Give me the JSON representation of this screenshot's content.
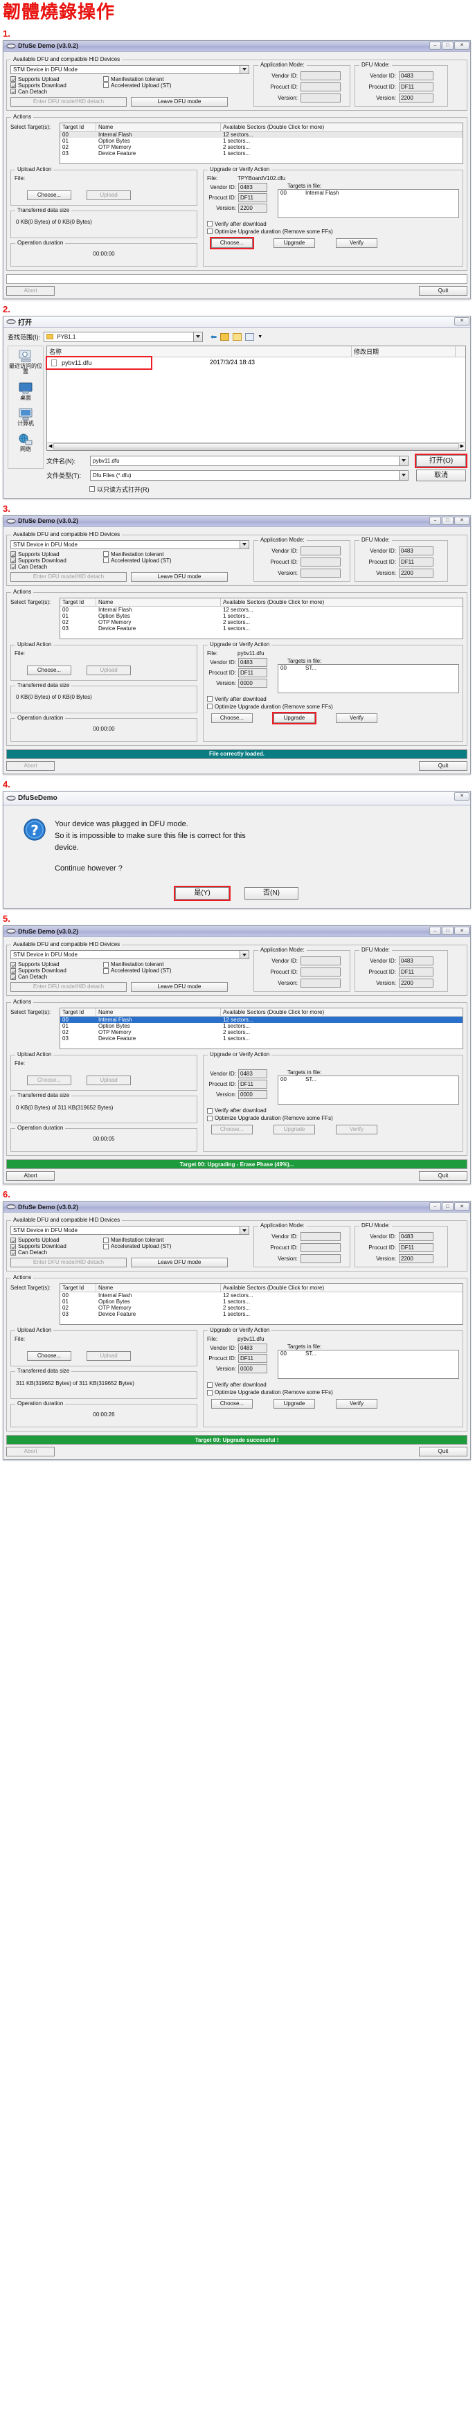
{
  "page_title": "韌體燒錄操作",
  "steps": {
    "s1": "1.",
    "s2": "2.",
    "s3": "3.",
    "s4": "4.",
    "s5": "5.",
    "s6": "6."
  },
  "app": {
    "title": "DfuSe Demo (v3.0.2)",
    "title_short": "DfuSeDemo",
    "group_devices": "Available DFU and compatible HID Devices",
    "device_selected": "STM Device in DFU Mode",
    "checks": {
      "supports_upload": "Supports Upload",
      "supports_download": "Supports Download",
      "can_detach": "Can Detach",
      "manifestation_tolerant": "Manifestation tolerant",
      "accelerated_upload": "Accelerated Upload (ST)"
    },
    "btn_enter_dfu": "Enter DFU mode/HID detach",
    "btn_leave_dfu": "Leave DFU mode",
    "app_mode": {
      "title": "Application Mode:",
      "vendor_label": "Vendor ID:",
      "product_label": "Procuct ID:",
      "version_label": "Version:",
      "vendor_value": "",
      "product_value": "",
      "version_value": ""
    },
    "dfu_mode": {
      "title": "DFU Mode:",
      "vendor_label": "Vendor ID:",
      "product_label": "Procuct ID:",
      "version_label": "Version:",
      "vendor_value": "0483",
      "product_value": "DF11",
      "version_value": "2200"
    },
    "actions_title": "Actions",
    "select_targets_label": "Select Target(s):",
    "target_columns": [
      "Target Id",
      "Name",
      "Available Sectors (Double Click for more)"
    ],
    "targets": [
      {
        "id": "00",
        "name": "Internal Flash",
        "sectors": "12 sectors..."
      },
      {
        "id": "01",
        "name": "Option Bytes",
        "sectors": "1 sectors..."
      },
      {
        "id": "02",
        "name": "OTP Memory",
        "sectors": "2 sectors..."
      },
      {
        "id": "03",
        "name": "Device Feature",
        "sectors": "1 sectors..."
      }
    ],
    "upload_action": {
      "title": "Upload Action",
      "file_label": "File:",
      "file_value": "",
      "btn_choose": "Choose...",
      "btn_upload": "Upload"
    },
    "transferred": {
      "title": "Transferred data size",
      "value_idle": "0 KB(0 Bytes) of 0 KB(0 Bytes)",
      "value_busy": "0 KB(0 Bytes) of 311 KB(319652 Bytes)",
      "value_done": "311 KB(319652 Bytes) of 311 KB(319652 Bytes)"
    },
    "operation": {
      "title": "Operation duration",
      "t_idle": "00:00:00",
      "t_busy": "00:00:05",
      "t_done": "00:00:26"
    },
    "upgrade_action": {
      "title": "Upgrade or Verify Action",
      "file_label": "File:",
      "file_value_1": "TPYBoardV102.dfu",
      "file_value_2": "pybv11.dfu",
      "vendor_label": "Vendor ID:",
      "product_label": "Procuct ID:",
      "version_label": "Version:",
      "vendor_value": "0483",
      "product_value": "DF11",
      "version_value_1": "2200",
      "version_value_2": "0000",
      "targets_in_file_label": "Targets in file:",
      "target_row_1_id": "00",
      "target_row_1_name": "Internal Flash",
      "target_row_2_id": "00",
      "target_row_2_name": "ST...",
      "chk_verify": "Verify after download",
      "chk_optimize": "Optimize Upgrade duration (Remove some FFs)",
      "btn_choose": "Choose...",
      "btn_upgrade": "Upgrade",
      "btn_verify": "Verify"
    },
    "btn_abort": "Abort",
    "btn_quit": "Quit",
    "status_blank": "",
    "status_loaded": "File correctly loaded.",
    "status_upgrading": "Target 00: Upgrading - Erase Phase (49%)...",
    "status_success": "Target 00: Upgrade successful !"
  },
  "open_dialog": {
    "title": "打开",
    "look_in_label": "查找范围(I):",
    "look_in_value": "PYB1.1",
    "toolbar_icons": [
      "back-arrow-icon",
      "up-folder-icon",
      "new-folder-icon",
      "views-icon"
    ],
    "columns": [
      "名称",
      "修改日期"
    ],
    "files": [
      {
        "name": "pybv11.dfu",
        "modified": "2017/3/24 18:43"
      }
    ],
    "places": [
      {
        "label": "最近访问的位置",
        "icon": "recent-places-icon"
      },
      {
        "label": "桌面",
        "icon": "desktop-icon"
      },
      {
        "label": "计算机",
        "icon": "computer-icon"
      },
      {
        "label": "网络",
        "icon": "network-icon"
      }
    ],
    "filename_label": "文件名(N):",
    "filename_value": "pybv11.dfu",
    "filetype_label": "文件类型(T):",
    "filetype_value": "Dfu Files (*.dfu)",
    "readonly_label": "以只读方式打开(R)",
    "btn_open": "打开(O)",
    "btn_cancel": "取消"
  },
  "msgbox": {
    "title": "DfuSeDemo",
    "line1": "Your device was plugged in DFU mode.",
    "line2": "So it is impossible to make sure this file is correct for this",
    "line3": "device.",
    "line4": "Continue however ?",
    "btn_yes": "是(Y)",
    "btn_no": "否(N)"
  }
}
